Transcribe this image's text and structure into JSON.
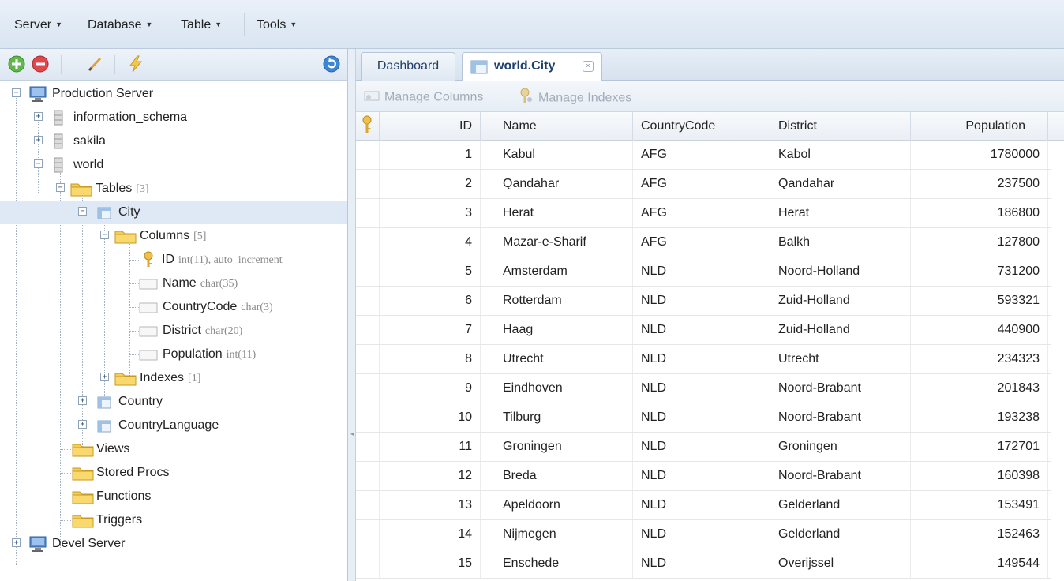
{
  "menubar": {
    "items": [
      {
        "label": "Server"
      },
      {
        "label": "Database"
      },
      {
        "label": "Table"
      },
      {
        "label": "Tools"
      }
    ]
  },
  "left_toolbar": {
    "icons": [
      "add-icon",
      "remove-icon",
      "edit-icon",
      "lightning-icon",
      "refresh-icon"
    ]
  },
  "tree": {
    "production_server": "Production Server",
    "information_schema": "information_schema",
    "sakila": "sakila",
    "world": "world",
    "tables": {
      "label": "Tables",
      "count": "[3]"
    },
    "city": "City",
    "columns": {
      "label": "Columns",
      "count": "[5]"
    },
    "col_id": {
      "name": "ID",
      "type": "int(11), auto_increment"
    },
    "col_name": {
      "name": "Name",
      "type": "char(35)"
    },
    "col_countrycode": {
      "name": "CountryCode",
      "type": "char(3)"
    },
    "col_district": {
      "name": "District",
      "type": "char(20)"
    },
    "col_population": {
      "name": "Population",
      "type": "int(11)"
    },
    "indexes": {
      "label": "Indexes",
      "count": "[1]"
    },
    "country": "Country",
    "countrylanguage": "CountryLanguage",
    "views": "Views",
    "stored_procs": "Stored Procs",
    "functions": "Functions",
    "triggers": "Triggers",
    "devel_server": "Devel Server"
  },
  "tabs": [
    {
      "label": "Dashboard"
    },
    {
      "label": "world.City",
      "close": "×"
    }
  ],
  "subtoolbar": {
    "manage_columns": "Manage Columns",
    "manage_indexes": "Manage Indexes"
  },
  "grid": {
    "columns": [
      "ID",
      "Name",
      "CountryCode",
      "District",
      "Population"
    ],
    "rows": [
      [
        "1",
        "Kabul",
        "AFG",
        "Kabol",
        "1780000"
      ],
      [
        "2",
        "Qandahar",
        "AFG",
        "Qandahar",
        "237500"
      ],
      [
        "3",
        "Herat",
        "AFG",
        "Herat",
        "186800"
      ],
      [
        "4",
        "Mazar-e-Sharif",
        "AFG",
        "Balkh",
        "127800"
      ],
      [
        "5",
        "Amsterdam",
        "NLD",
        "Noord-Holland",
        "731200"
      ],
      [
        "6",
        "Rotterdam",
        "NLD",
        "Zuid-Holland",
        "593321"
      ],
      [
        "7",
        "Haag",
        "NLD",
        "Zuid-Holland",
        "440900"
      ],
      [
        "8",
        "Utrecht",
        "NLD",
        "Utrecht",
        "234323"
      ],
      [
        "9",
        "Eindhoven",
        "NLD",
        "Noord-Brabant",
        "201843"
      ],
      [
        "10",
        "Tilburg",
        "NLD",
        "Noord-Brabant",
        "193238"
      ],
      [
        "11",
        "Groningen",
        "NLD",
        "Groningen",
        "172701"
      ],
      [
        "12",
        "Breda",
        "NLD",
        "Noord-Brabant",
        "160398"
      ],
      [
        "13",
        "Apeldoorn",
        "NLD",
        "Gelderland",
        "153491"
      ],
      [
        "14",
        "Nijmegen",
        "NLD",
        "Gelderland",
        "152463"
      ],
      [
        "15",
        "Enschede",
        "NLD",
        "Overijssel",
        "149544"
      ]
    ]
  }
}
